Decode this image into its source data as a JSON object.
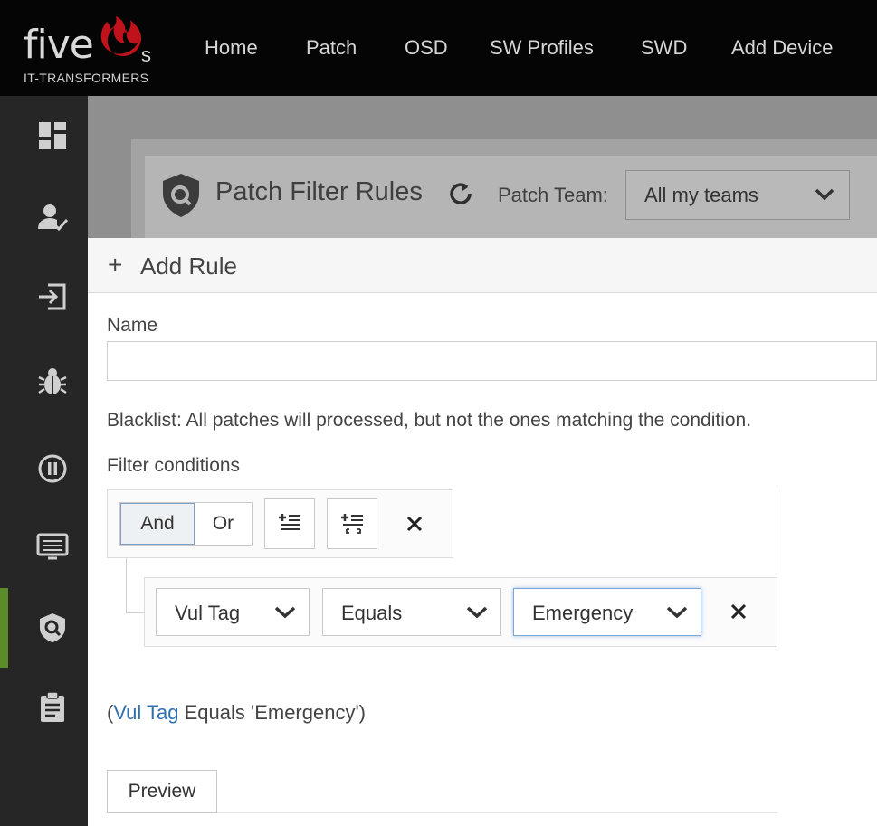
{
  "brand": {
    "wordmark": "five",
    "suffix": "s",
    "subtitle": "IT-TRANSFORMERS",
    "flame_color": "#c0121a"
  },
  "nav": {
    "items": [
      {
        "label": "Home"
      },
      {
        "label": "Patch"
      },
      {
        "label": "OSD"
      },
      {
        "label": "SW Profiles"
      },
      {
        "label": "SWD"
      },
      {
        "label": "Add Device"
      }
    ]
  },
  "sidebar": {
    "icons": [
      "dashboard-icon",
      "user-check-icon",
      "sign-in-icon",
      "bug-icon",
      "pause-circle-icon",
      "monitor-icon",
      "shield-search-icon",
      "clipboard-icon"
    ],
    "active_index": 6,
    "active_color": "#5b8c2a"
  },
  "page": {
    "title": "Patch Filter Rules",
    "team_label": "Patch Team:",
    "team_value": "All my teams"
  },
  "modal": {
    "title": "Add Rule",
    "name_label": "Name",
    "name_value": "",
    "blacklist_text": "Blacklist: All patches will processed, but not the ones matching the condition.",
    "filter_label": "Filter conditions",
    "and_label": "And",
    "or_label": "Or",
    "rule": {
      "field": "Vul Tag",
      "operator": "Equals",
      "value": "Emergency"
    },
    "expression": {
      "open": "(",
      "field": "Vul Tag",
      "rest": " Equals 'Emergency')"
    },
    "preview_label": "Preview"
  }
}
